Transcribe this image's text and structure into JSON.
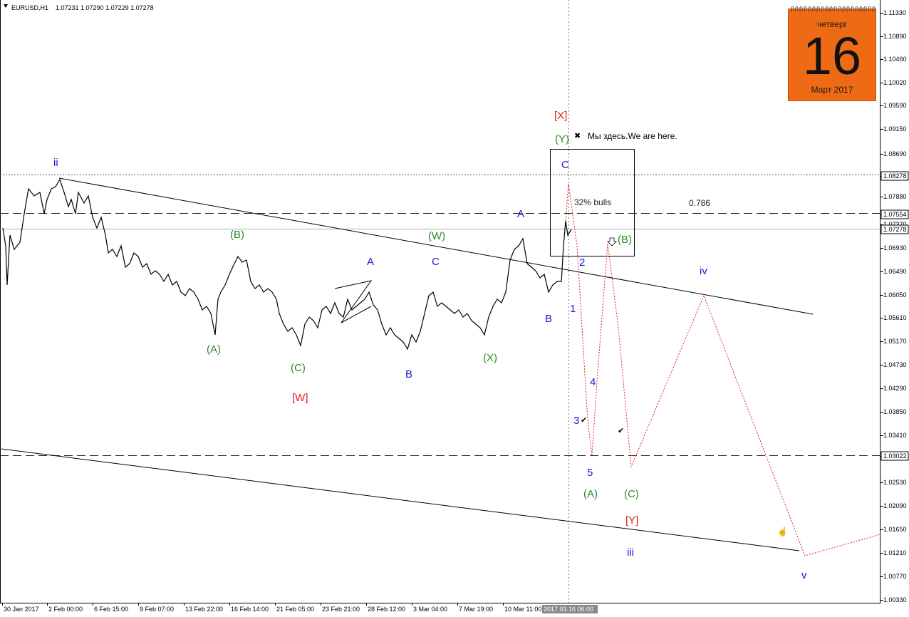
{
  "header": {
    "symbol_label": "EURUSD,H1",
    "ohlc": "1.07231 1.07290 1.07229 1.07278"
  },
  "price_axis": {
    "ticks": [
      "1.11330",
      "1.10890",
      "1.10460",
      "1.10020",
      "1.09590",
      "1.09150",
      "1.08690",
      "1.08278",
      "1.07880",
      "1.07554",
      "1.07370",
      "1.07278",
      "1.06930",
      "1.06490",
      "1.06050",
      "1.05610",
      "1.05170",
      "1.04730",
      "1.04290",
      "1.03850",
      "1.03410",
      "1.03022",
      "1.02530",
      "1.02090",
      "1.01650",
      "1.01210",
      "1.00770",
      "1.00330"
    ],
    "boxed": [
      "1.08278",
      "1.07554",
      "1.07278",
      "1.03022"
    ]
  },
  "time_axis": {
    "labels": [
      "30 Jan 2017",
      "2 Feb 00:00",
      "6 Feb 15:00",
      "9 Feb 07:00",
      "13 Feb 22:00",
      "16 Feb 14:00",
      "21 Feb 05:00",
      "23 Feb 21:00",
      "28 Feb 12:00",
      "3 Mar 04:00",
      "7 Mar 19:00",
      "10 Mar 11:00"
    ],
    "current": "2017.03.16 06:00"
  },
  "wave_labels": [
    {
      "text": "ii",
      "color": "#1a1ad6"
    },
    {
      "text": "(A)",
      "color": "#2a8a2a"
    },
    {
      "text": "(B)",
      "color": "#2a8a2a"
    },
    {
      "text": "(C)",
      "color": "#2a8a2a"
    },
    {
      "text": "[W]",
      "color": "#e02020"
    },
    {
      "text": "A",
      "color": "#1a1ad6"
    },
    {
      "text": "B",
      "color": "#1a1ad6"
    },
    {
      "text": "(W)",
      "color": "#2a8a2a"
    },
    {
      "text": "C",
      "color": "#1a1ad6"
    },
    {
      "text": "(X)",
      "color": "#2a8a2a"
    },
    {
      "text": "A",
      "color": "#1a1ad6"
    },
    {
      "text": "B",
      "color": "#1a1ad6"
    },
    {
      "text": "C",
      "color": "#1a1ad6"
    },
    {
      "text": "[X]",
      "color": "#e02020"
    },
    {
      "text": "(Y)",
      "color": "#2a8a2a"
    },
    {
      "text": "1",
      "color": "#1a1ad6"
    },
    {
      "text": "2",
      "color": "#1a1ad6"
    },
    {
      "text": "3",
      "color": "#1a1ad6"
    },
    {
      "text": "4",
      "color": "#1a1ad6"
    },
    {
      "text": "5",
      "color": "#1a1ad6"
    },
    {
      "text": "(A)",
      "color": "#2a8a2a"
    },
    {
      "text": "(B)",
      "color": "#2a8a2a"
    },
    {
      "text": "(C)",
      "color": "#2a8a2a"
    },
    {
      "text": "[Y]",
      "color": "#e02020"
    },
    {
      "text": "iii",
      "color": "#1a1ad6"
    },
    {
      "text": "iv",
      "color": "#1a1ad6"
    },
    {
      "text": "v",
      "color": "#1a1ad6"
    }
  ],
  "annotations": {
    "here": "Мы здесь.We are here.",
    "bulls": "32% bulls",
    "fib": "0.786"
  },
  "calendar": {
    "day_name": "четверг",
    "day_number": "16",
    "month_year": "Март 2017"
  },
  "colors": {
    "price_line": "#000000",
    "projection": "#e02020",
    "blue": "#1a1ad6",
    "green": "#2a8a2a",
    "red": "#e02020",
    "calendar_bg": "#ee6a14"
  }
}
